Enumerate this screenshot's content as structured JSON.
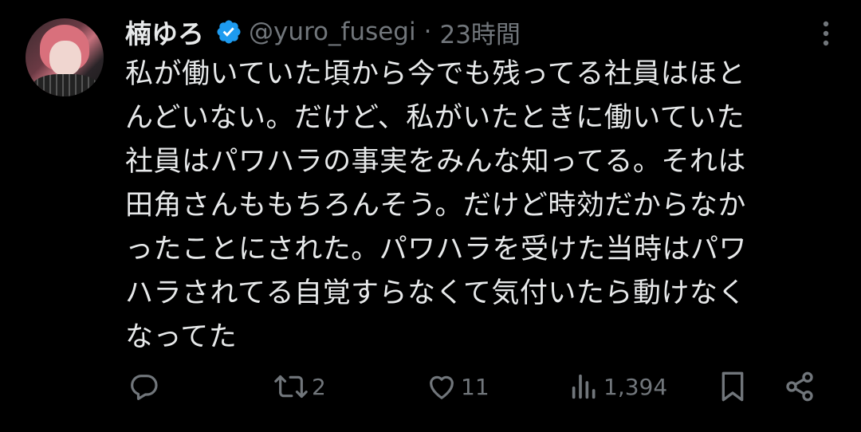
{
  "tweet": {
    "display_name": "楠ゆろ",
    "handle": "@yuro_fusegi",
    "separator": "·",
    "time": "23時間",
    "body_lines": [
      "私が働いていた頃から今でも残ってる社員はほと",
      "んどいない。だけど、私がいたときに働いていた",
      "社員はパワハラの事実をみんな知ってる。それは",
      "田角さんももちろんそう。だけど時効だからなか",
      "ったことにされた。パワハラを受けた当時はパワ",
      "ハラされてる自覚すらなくて気付いたら動けなく",
      "なってた"
    ],
    "verified_color": "#1d9bf0"
  },
  "actions": {
    "reply_count": "",
    "retweet_count": "2",
    "like_count": "11",
    "views_count": "1,394"
  },
  "icons": {
    "verified": "verified-badge-icon",
    "more": "more-options-icon",
    "reply": "reply-icon",
    "retweet": "retweet-icon",
    "like": "heart-icon",
    "views": "views-bar-chart-icon",
    "bookmark": "bookmark-icon",
    "share": "share-icon"
  },
  "colors": {
    "background": "#000000",
    "text": "#e7e9ea",
    "muted": "#71767b",
    "accent": "#1d9bf0"
  }
}
